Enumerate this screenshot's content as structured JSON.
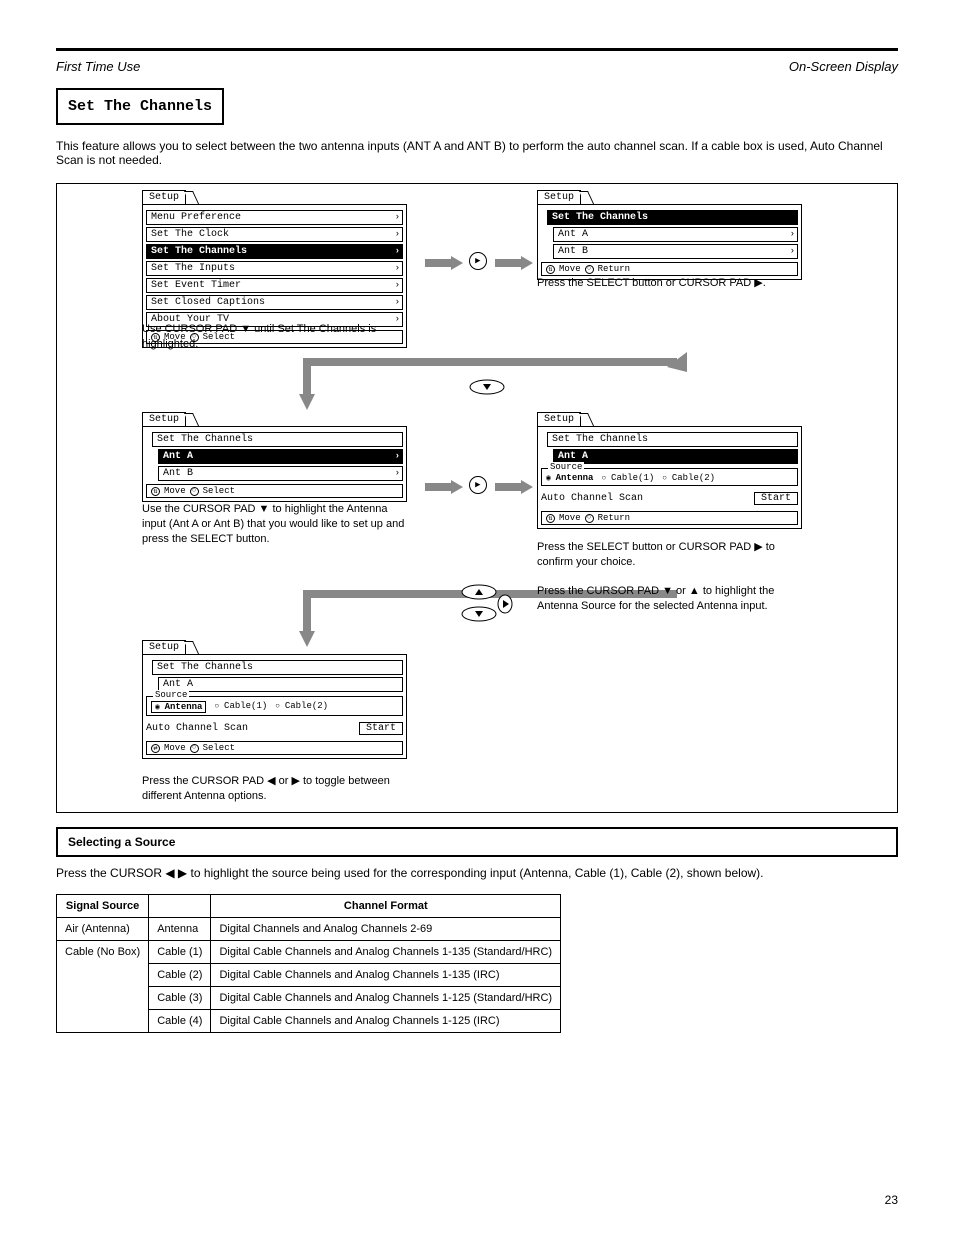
{
  "header": {
    "left": "First Time Use",
    "right": "On-Screen Display"
  },
  "title": "Set The Channels",
  "intro": "This feature allows you to select between the two antenna inputs (ANT A and ANT B) to perform the auto channel scan. If a cable box is used, Auto Channel Scan is not needed.",
  "osd": {
    "setup": "Setup",
    "menu_pref": "Menu Preference",
    "set_clock": "Set The Clock",
    "set_channels": "Set The Channels",
    "set_inputs": "Set The Inputs",
    "set_event": "Set Event Timer",
    "set_cc": "Set Closed Captions",
    "about": "About Your TV",
    "ant_a": "Ant A",
    "ant_b": "Ant B",
    "source": "Source",
    "antenna": "Antenna",
    "cable1": "Cable(1)",
    "cable2": "Cable(2)",
    "acs": "Auto Channel Scan",
    "start": "Start",
    "move": "Move",
    "select": "Select",
    "ret": "Return"
  },
  "captions": {
    "c1": "Use CURSOR PAD ▼ until Set The Channels is highlighted.",
    "c2": "Press the SELECT button or CURSOR PAD ▶.",
    "c3": "Use the CURSOR PAD ▼ to highlight the Antenna input (Ant A or Ant B) that you would like to set up and press the SELECT button.",
    "c4": "Press the SELECT button or CURSOR PAD ▶ to confirm your choice.",
    "c5": "Press the CURSOR PAD ▼ or ▲ to highlight the Antenna Source for the selected Antenna input.",
    "c6": "Press the CURSOR PAD ◀ or ▶ to toggle between different Antenna options."
  },
  "sel_source": {
    "title": "Selecting a Source"
  },
  "sel_text": "Press the CURSOR ◀ ▶ to highlight the source being used for the corresponding input (Antenna, Cable (1), Cable (2), shown below).",
  "table": {
    "h1": "Signal Source",
    "h2": " ",
    "h3": "Channel Format",
    "r1c1": "Air (Antenna)",
    "r1c2": "Antenna",
    "r1c3": "Digital Channels and Analog Channels 2-69",
    "r2c1": "Cable (No Box)",
    "r2ac2": "Cable (1)",
    "r2ac3": "Digital Cable Channels and Analog Channels 1-135 (Standard/HRC)",
    "r2bc2": "Cable (2)",
    "r2bc3": "Digital Cable Channels and Analog Channels 1-135 (IRC)",
    "r2cc2": "Cable (3)",
    "r2cc3": "Digital Cable Channels and Analog Channels 1-125 (Standard/HRC)",
    "r2dc2": "Cable (4)",
    "r2dc3": "Digital Cable Channels and Analog Channels 1-125 (IRC)"
  },
  "page": "23"
}
